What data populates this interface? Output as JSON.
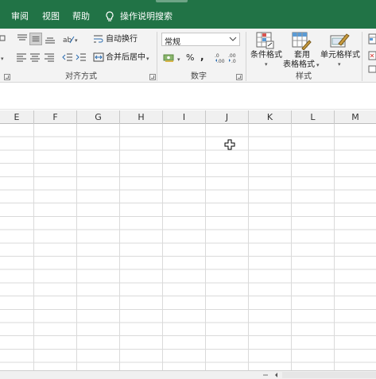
{
  "menu": {
    "tabs": [
      "审阅",
      "视图",
      "帮助"
    ],
    "tell_me": "操作说明搜索"
  },
  "ribbon": {
    "wrap_text": "自动换行",
    "merge_center": "合并后居中",
    "number_format": "常规",
    "percent": "%",
    "comma": ",",
    "conditional_format": "条件格式",
    "table_format_line1": "套用",
    "table_format_line2": "表格格式",
    "cell_styles": "单元格样式",
    "group_alignment": "对齐方式",
    "group_number": "数字",
    "group_styles": "样式"
  },
  "columns": [
    "E",
    "F",
    "G",
    "H",
    "I",
    "J",
    "K",
    "L",
    "M"
  ],
  "colors": {
    "brand": "#217346",
    "ribbon": "#f3f3f3",
    "grid": "#dadada"
  }
}
